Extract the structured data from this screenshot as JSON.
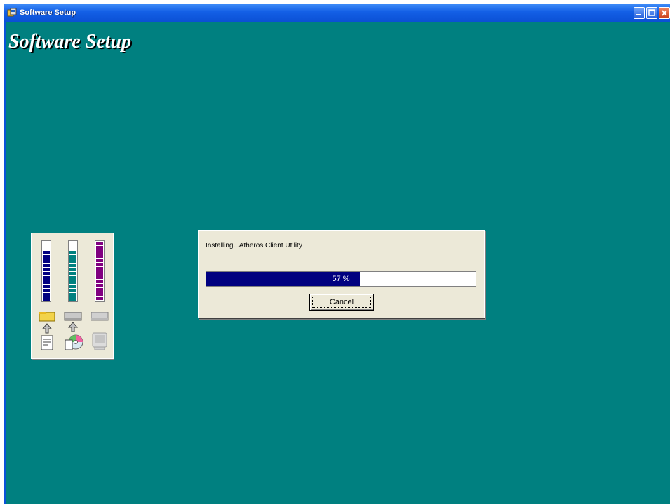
{
  "window": {
    "title": "Software Setup",
    "icon": "setup-app-icon",
    "buttons": [
      "minimize-icon",
      "maximize-icon",
      "close-icon"
    ]
  },
  "main": {
    "heading": "Software Setup",
    "background_color": "#008080"
  },
  "status_panel": {
    "meters": [
      {
        "name": "meter-1",
        "color": "#000080",
        "level": 0.85
      },
      {
        "name": "meter-2",
        "color": "#008080",
        "level": 0.85
      },
      {
        "name": "meter-3",
        "color": "#800080",
        "level": 1.0
      }
    ],
    "steps": [
      {
        "icon": "folder-to-file-icon",
        "state": "active"
      },
      {
        "icon": "cd-install-icon",
        "state": "active"
      },
      {
        "icon": "computer-icon",
        "state": "inactive"
      }
    ]
  },
  "dialog": {
    "status_text": "Installing...Atheros Client Utility",
    "progress_percent": 57,
    "progress_label": "57 %",
    "progress_color": "#000080",
    "cancel_label": "Cancel"
  }
}
